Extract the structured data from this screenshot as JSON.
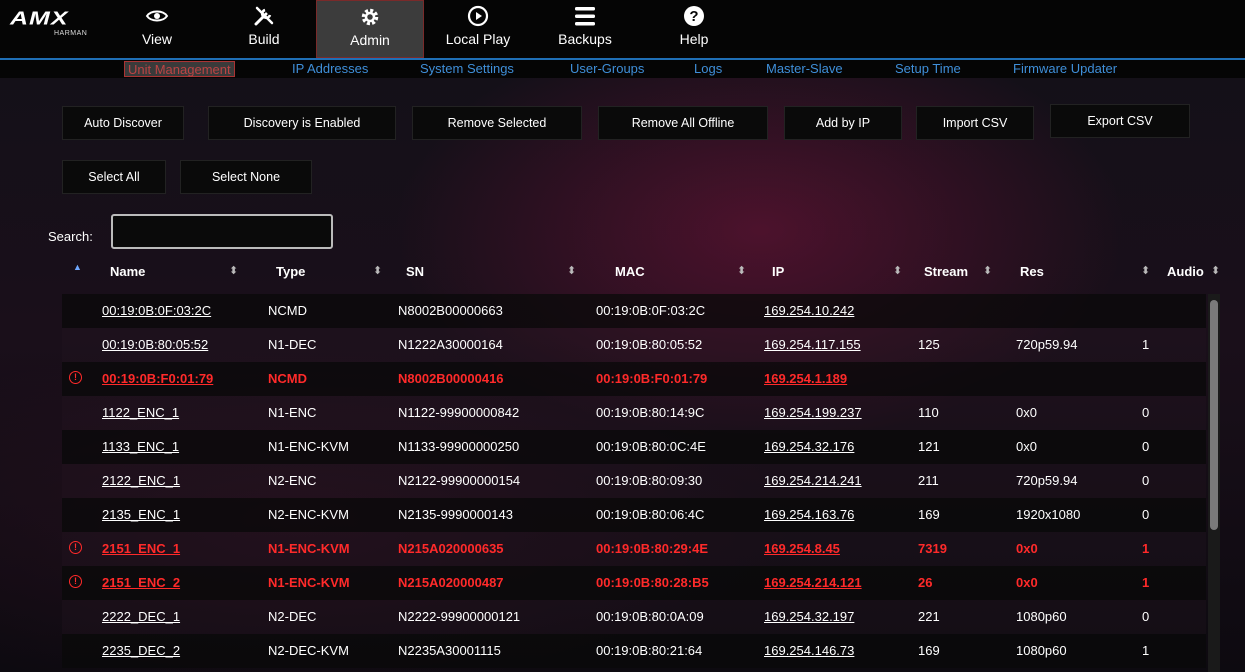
{
  "brand": {
    "logo": "AMX",
    "sub": "HARMAN"
  },
  "nav": [
    {
      "label": "View",
      "icon": "eye-icon"
    },
    {
      "label": "Build",
      "icon": "tools-icon"
    },
    {
      "label": "Admin",
      "icon": "gear-icon",
      "active": true
    },
    {
      "label": "Local Play",
      "icon": "play-circle-icon"
    },
    {
      "label": "Backups",
      "icon": "menu-icon"
    },
    {
      "label": "Help",
      "icon": "help-icon"
    }
  ],
  "subnav": [
    {
      "label": "Unit Management",
      "active": true
    },
    {
      "label": "IP Addresses"
    },
    {
      "label": "System Settings"
    },
    {
      "label": "User-Groups"
    },
    {
      "label": "Logs"
    },
    {
      "label": "Master-Slave"
    },
    {
      "label": "Setup Time"
    },
    {
      "label": "Firmware Updater"
    }
  ],
  "actions": [
    "Auto Discover",
    "Discovery is Enabled",
    "Remove Selected",
    "Remove All Offline",
    "Add by IP",
    "Import CSV",
    "Export CSV"
  ],
  "selection": [
    "Select All",
    "Select None"
  ],
  "search": {
    "label": "Search:",
    "value": ""
  },
  "columns": [
    "Name",
    "Type",
    "SN",
    "MAC",
    "IP",
    "Stream",
    "Res",
    "Audio"
  ],
  "rows": [
    {
      "name": "00:19:0B:0F:03:2C",
      "type": "NCMD",
      "sn": "N8002B00000663",
      "mac": "00:19:0B:0F:03:2C",
      "ip": "169.254.10.242",
      "stream": "",
      "res": "",
      "audio": "",
      "offline": false
    },
    {
      "name": "00:19:0B:80:05:52",
      "type": "N1-DEC",
      "sn": "N1222A30000164",
      "mac": "00:19:0B:80:05:52",
      "ip": "169.254.117.155",
      "stream": "125",
      "res": "720p59.94",
      "audio": "1",
      "offline": false
    },
    {
      "name": "00:19:0B:F0:01:79",
      "type": "NCMD",
      "sn": "N8002B00000416",
      "mac": "00:19:0B:F0:01:79",
      "ip": "169.254.1.189",
      "stream": "",
      "res": "",
      "audio": "",
      "offline": true
    },
    {
      "name": "1122_ENC_1",
      "type": "N1-ENC",
      "sn": "N1122-99900000842",
      "mac": "00:19:0B:80:14:9C",
      "ip": "169.254.199.237",
      "stream": "110",
      "res": "0x0",
      "audio": "0",
      "offline": false
    },
    {
      "name": "1133_ENC_1",
      "type": "N1-ENC-KVM",
      "sn": "N1133-99900000250",
      "mac": "00:19:0B:80:0C:4E",
      "ip": "169.254.32.176",
      "stream": "121",
      "res": "0x0",
      "audio": "0",
      "offline": false
    },
    {
      "name": "2122_ENC_1",
      "type": "N2-ENC",
      "sn": "N2122-99900000154",
      "mac": "00:19:0B:80:09:30",
      "ip": "169.254.214.241",
      "stream": "211",
      "res": "720p59.94",
      "audio": "0",
      "offline": false
    },
    {
      "name": "2135_ENC_1",
      "type": "N2-ENC-KVM",
      "sn": "N2135-9990000143",
      "mac": "00:19:0B:80:06:4C",
      "ip": "169.254.163.76",
      "stream": "169",
      "res": "1920x1080",
      "audio": "0",
      "offline": false
    },
    {
      "name": "2151_ENC_1",
      "type": "N1-ENC-KVM",
      "sn": "N215A020000635",
      "mac": "00:19:0B:80:29:4E",
      "ip": "169.254.8.45",
      "stream": "7319",
      "res": "0x0",
      "audio": "1",
      "offline": true
    },
    {
      "name": "2151_ENC_2",
      "type": "N1-ENC-KVM",
      "sn": "N215A020000487",
      "mac": "00:19:0B:80:28:B5",
      "ip": "169.254.214.121",
      "stream": "26",
      "res": "0x0",
      "audio": "1",
      "offline": true
    },
    {
      "name": "2222_DEC_1",
      "type": "N2-DEC",
      "sn": "N2222-99900000121",
      "mac": "00:19:0B:80:0A:09",
      "ip": "169.254.32.197",
      "stream": "221",
      "res": "1080p60",
      "audio": "0",
      "offline": false
    },
    {
      "name": "2235_DEC_2",
      "type": "N2-DEC-KVM",
      "sn": "N2235A30001115",
      "mac": "00:19:0B:80:21:64",
      "ip": "169.254.146.73",
      "stream": "169",
      "res": "1080p60",
      "audio": "1",
      "offline": false
    }
  ],
  "colors": {
    "accent": "#3f8fd9",
    "offline": "#ff2a2a",
    "active_tab": "#3c3c3c"
  }
}
